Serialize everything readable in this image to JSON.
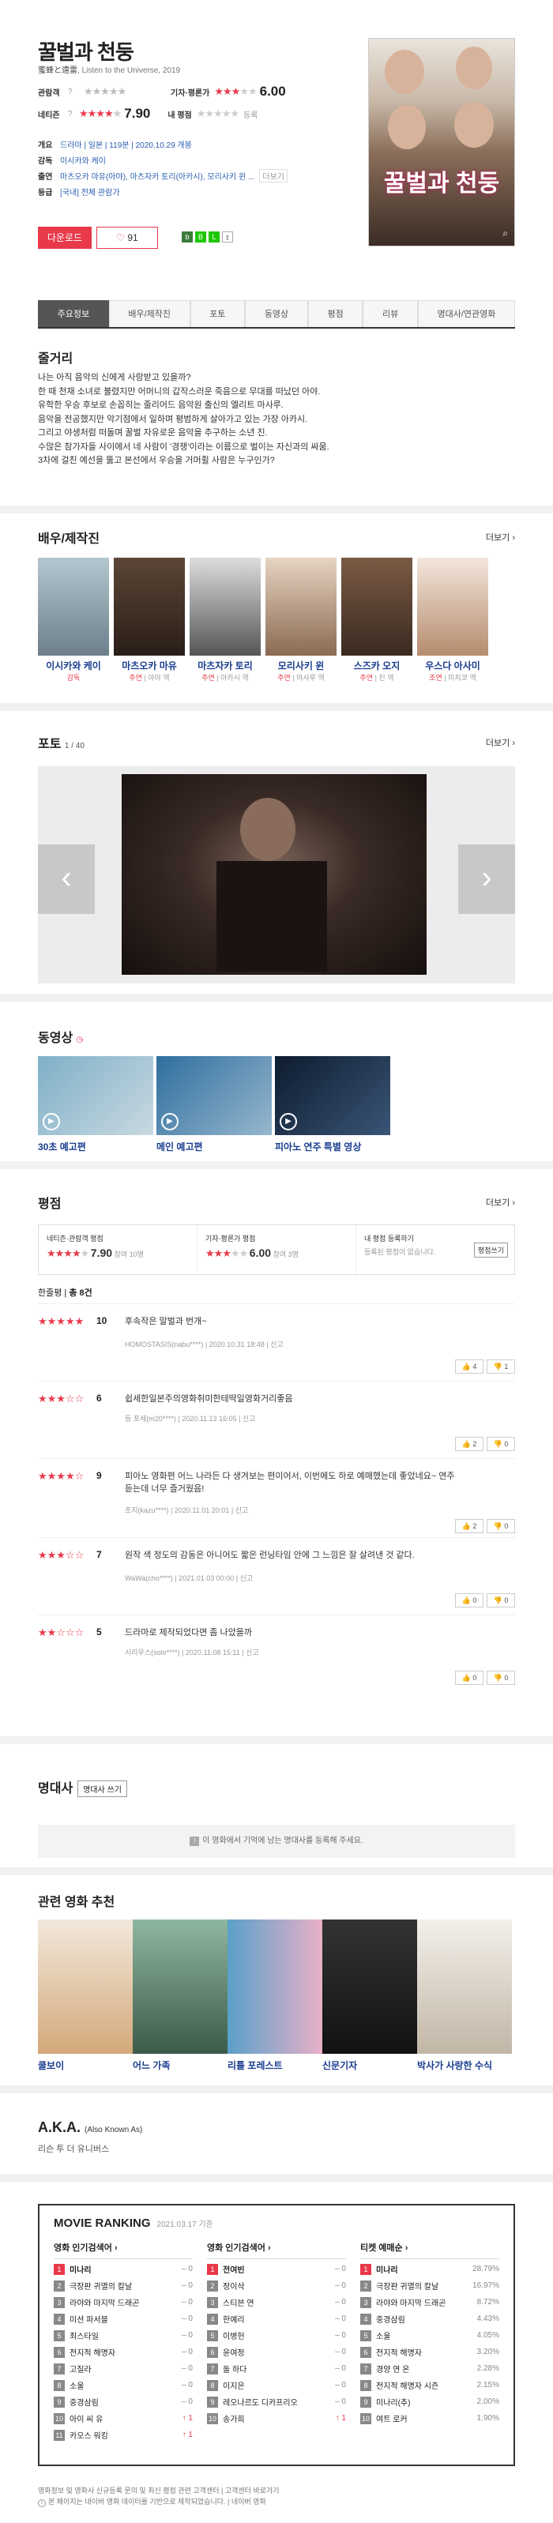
{
  "header": {
    "title_ko": "꿀벌과 천둥",
    "title_orig": "蜜蜂と遠雷",
    "title_en": "Listen to the Universe",
    "year": "2019",
    "audience_label": "관람객",
    "audience_note": "?",
    "critic_label": "기자·평론가",
    "critic_score": "6.00",
    "netizen_label": "네티즌",
    "netizen_score": "7.90",
    "my_label": "내 평점",
    "my_hint": "등록",
    "rows": [
      {
        "label": "개요",
        "value": "드라마 | 일본 | 119분 | 2020.10.29 개봉"
      },
      {
        "label": "감독",
        "value": "이시카와 케이"
      },
      {
        "label": "출연",
        "value": "마츠오카 마유(아야), 마츠자카 토리(아카시), 모리사키 윈 ..."
      },
      {
        "label": "등급",
        "value": "[국내] 전체 관람가"
      }
    ],
    "more_cast": "더보기",
    "poster_title": "꿀벌과 천둥",
    "download_label": "다운로드",
    "like_count": "91"
  },
  "tabs": [
    "주요정보",
    "배우/제작진",
    "포토",
    "동영상",
    "평점",
    "리뷰",
    "명대사/연관영화"
  ],
  "plot": {
    "title": "줄거리",
    "lines": [
      "나는 아직 음악의 신에게 사랑받고 있을까?",
      "한 때 천재 소녀로 불렸지만 어머니의 갑작스러운 죽음으로 무대를 떠났던 아야.",
      "유학한 우승 후보로 손꼽히는 줄리어드 음악원 출신의 엘리트 마사루.",
      "음악을 전공했지만 악기점에서 일하며 평범하게 살아가고 있는 가장 아카시.",
      "그리고 야생처럼 떠돌며 꿀벌 자유로운 음악을 추구하는 소년 진.",
      "수많은 참가자들 사이에서 네 사람이 '경쟁'이라는 이름으로 벌이는 자신과의 싸움.",
      "3차에 걸친 예선을 뚫고 본선에서 우승을 거머쥘 사람은 누구인가?"
    ]
  },
  "cast": {
    "title": "배우/제작진",
    "more": "더보기",
    "members": [
      {
        "name": "이시카와 케이",
        "role": "감독",
        "char": ""
      },
      {
        "name": "마츠오카 마유",
        "role": "주연",
        "char": "아야 역"
      },
      {
        "name": "마츠자카 토리",
        "role": "주연",
        "char": "아카시 역"
      },
      {
        "name": "모리사키 윈",
        "role": "주연",
        "char": "마사루 역"
      },
      {
        "name": "스즈카 오지",
        "role": "주연",
        "char": "진 역"
      },
      {
        "name": "우스다 아사미",
        "role": "조연",
        "char": "미치코 역"
      }
    ]
  },
  "photo": {
    "title": "포토",
    "counter": "1 / 40",
    "more": "더보기"
  },
  "videos": {
    "title": "동영상",
    "items": [
      {
        "title": "30초 예고편"
      },
      {
        "title": "메인 예고편"
      },
      {
        "title": "피아노 연주 특별 영상"
      }
    ]
  },
  "ratings": {
    "title": "평점",
    "more": "더보기",
    "netizen_box_label": "네티즌·관람객 평점",
    "netizen_score": "7.90",
    "netizen_count": "참여 10명",
    "critic_box_label": "기자·평론가 평점",
    "critic_score": "6.00",
    "critic_count": "참여 3명",
    "mine_label": "내 평점 등록하기",
    "mine_hint": "등록된 평점이 없습니다.",
    "mine_button": "평점쓰기",
    "summary_label": "한줄평",
    "summary_total": "총 8건",
    "reviews": [
      {
        "stars": "★★★★★",
        "score": "10",
        "text": "후속작은 말벌과 번개~",
        "meta": "HOMOSTASIS(nabu****) | 2020.10.31 18:48 | 신고",
        "up": "4",
        "down": "1"
      },
      {
        "stars": "★★★☆☆",
        "score": "6",
        "text": "쉽세한일본주의영화취미한테딱일영화거리좋음",
        "meta": "등 포세(m20****) | 2020.11.13 16:05 | 신고",
        "up": "2",
        "down": "0"
      },
      {
        "stars": "★★★★☆",
        "score": "9",
        "text": "피아노 영화편 어느 나라든 다 생겨보는 편이어서, 이번에도 하로 예매했는데 좋았네요~ 연주 듣는데 너무 즐거웠음!",
        "meta": "조지(kazu****) | 2020.11.01 20:01 | 신고",
        "up": "2",
        "down": "0"
      },
      {
        "stars": "★★★☆☆",
        "score": "7",
        "text": "원작 색 정도의 감동은 아니어도 짧은 런닝타임 안에 그 느낌은 잘 살려낸 것 같다.",
        "meta": "WaWa(cho****) | 2021.01.03 00:00 | 신고",
        "up": "0",
        "down": "0"
      },
      {
        "stars": "★★☆☆☆",
        "score": "5",
        "text": "드라마로 제작되었다면 좀 나았을까",
        "meta": "시리우스(solo****) | 2020.11.08 15:11 | 신고",
        "up": "0",
        "down": "0"
      }
    ]
  },
  "quotes": {
    "title": "명대사",
    "button": "명대사 쓰기",
    "empty": "이 영화에서 기억에 남는 명대사를 등록해 주세요."
  },
  "related": {
    "title": "관련 영화 추천",
    "items": [
      "쿨보이",
      "어느 가족",
      "리틀 포레스트",
      "신문기자",
      "박사가 사랑한 수식"
    ]
  },
  "aka": {
    "title": "A.K.A.",
    "subtitle": "(Also Known As)",
    "value": "리슨 투 더 유니버스"
  },
  "ranking": {
    "title": "MOVIE RANKING",
    "date": "2021.03.17 기준",
    "columns": [
      {
        "title": "영화 인기검색어",
        "rows": [
          {
            "n": "1",
            "name": "미나리",
            "chg": "0"
          },
          {
            "n": "2",
            "name": "극장판 귀멸의 칼날",
            "chg": "0"
          },
          {
            "n": "3",
            "name": "라야와 마지막 드래곤",
            "chg": "0"
          },
          {
            "n": "4",
            "name": "미션 파서블",
            "chg": "0"
          },
          {
            "n": "5",
            "name": "최스타일",
            "chg": "0"
          },
          {
            "n": "6",
            "name": "전지적 해명자",
            "chg": "0"
          },
          {
            "n": "7",
            "name": "고질라",
            "chg": "0"
          },
          {
            "n": "8",
            "name": "소울",
            "chg": "0"
          },
          {
            "n": "9",
            "name": "중경삼림",
            "chg": "0"
          },
          {
            "n": "10",
            "name": "아이 씨 유",
            "chg": "1"
          },
          {
            "n": "11",
            "name": "카오스 워킹",
            "chg": "1"
          }
        ]
      },
      {
        "title": "영화 인기검색어",
        "rows": [
          {
            "n": "1",
            "name": "전여빈",
            "chg": "0"
          },
          {
            "n": "2",
            "name": "정이삭",
            "chg": "0"
          },
          {
            "n": "3",
            "name": "스티븐 연",
            "chg": "0"
          },
          {
            "n": "4",
            "name": "한예리",
            "chg": "0"
          },
          {
            "n": "5",
            "name": "이병헌",
            "chg": "0"
          },
          {
            "n": "6",
            "name": "윤여정",
            "chg": "0"
          },
          {
            "n": "7",
            "name": "돌 하다",
            "chg": "0"
          },
          {
            "n": "8",
            "name": "이지은",
            "chg": "0"
          },
          {
            "n": "9",
            "name": "레오나르도 디카프리오",
            "chg": "0"
          },
          {
            "n": "10",
            "name": "송가희",
            "chg": "1"
          }
        ]
      },
      {
        "title": "티켓 예매순",
        "rows": [
          {
            "n": "1",
            "name": "미나리",
            "chg": "28.79%"
          },
          {
            "n": "2",
            "name": "극장판 귀멸의 칼날",
            "chg": "16.97%"
          },
          {
            "n": "3",
            "name": "라야와 마지막 드래곤",
            "chg": "8.72%"
          },
          {
            "n": "4",
            "name": "중경삼림",
            "chg": "4.43%"
          },
          {
            "n": "5",
            "name": "소울",
            "chg": "4.05%"
          },
          {
            "n": "6",
            "name": "전지적 해명자",
            "chg": "3.20%"
          },
          {
            "n": "7",
            "name": "경양 연 온",
            "chg": "2.28%"
          },
          {
            "n": "8",
            "name": "전지적 해명자 시즌",
            "chg": "2.15%"
          },
          {
            "n": "9",
            "name": "미나리(추)",
            "chg": "2.00%"
          },
          {
            "n": "10",
            "name": "여트 로커",
            "chg": "1.90%"
          }
        ]
      }
    ]
  },
  "footer": {
    "line1": "영화정보 및 영화사 신규등록 문의 및 최신 평점 관련 고객센터 | 고객센터 바로가기",
    "line2": "본 페이지는 네이버 영화 데이터를 기반으로 제작되었습니다. | 네이버 영화"
  },
  "colors": {
    "accent": "#e8394a",
    "link": "#1a3d8f"
  }
}
